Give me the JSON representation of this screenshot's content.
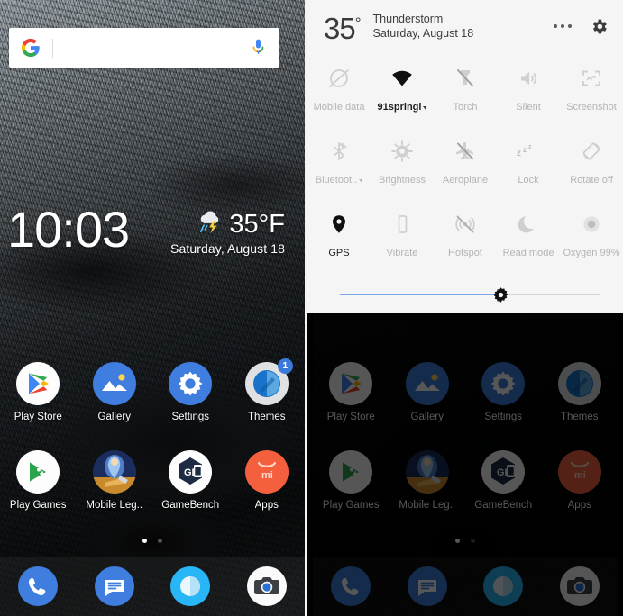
{
  "home": {
    "search": {
      "placeholder": "",
      "value": "",
      "logo": "google-g-logo",
      "mic": "microphone-icon"
    },
    "clock": {
      "time": "10:03",
      "temperature": "35°F",
      "date": "Saturday, August 18",
      "condition_icon": "thunderstorm-icon"
    },
    "apps": [
      [
        {
          "label": "Play Store",
          "icon": "play-store-icon",
          "badge": ""
        },
        {
          "label": "Gallery",
          "icon": "gallery-icon",
          "badge": ""
        },
        {
          "label": "Settings",
          "icon": "settings-gear-icon",
          "badge": ""
        },
        {
          "label": "Themes",
          "icon": "themes-icon",
          "badge": "1"
        }
      ],
      [
        {
          "label": "Play Games",
          "icon": "play-games-icon",
          "badge": ""
        },
        {
          "label": "Mobile Leg..",
          "icon": "mobile-legends-icon",
          "badge": ""
        },
        {
          "label": "GameBench",
          "icon": "gamebench-icon",
          "badge": ""
        },
        {
          "label": "Apps",
          "icon": "mi-apps-icon",
          "badge": ""
        }
      ]
    ],
    "pages": {
      "count": 2,
      "active": 1
    },
    "dock": [
      {
        "label": "Phone",
        "icon": "phone-icon"
      },
      {
        "label": "Messages",
        "icon": "messages-icon"
      },
      {
        "label": "Browser",
        "icon": "browser-icon"
      },
      {
        "label": "Camera",
        "icon": "camera-icon"
      }
    ]
  },
  "quick_settings": {
    "header": {
      "temperature": "35",
      "degree": "°",
      "condition": "Thunderstorm",
      "date": "Saturday, August 18",
      "overflow_icon": "more-options-icon",
      "settings_icon": "gear-icon"
    },
    "tiles": [
      [
        {
          "label": "Mobile data",
          "icon": "mobile-data-off-icon",
          "enabled": false,
          "has_caret": false
        },
        {
          "label": "91springl",
          "icon": "wifi-icon",
          "enabled": true,
          "has_caret": true
        },
        {
          "label": "Torch",
          "icon": "torch-off-icon",
          "enabled": false,
          "has_caret": false
        },
        {
          "label": "Silent",
          "icon": "volume-icon",
          "enabled": false,
          "has_caret": false
        },
        {
          "label": "Screenshot",
          "icon": "screenshot-icon",
          "enabled": false,
          "has_caret": false
        }
      ],
      [
        {
          "label": "Bluetoot..",
          "icon": "bluetooth-off-icon",
          "enabled": false,
          "has_caret": true
        },
        {
          "label": "Brightness",
          "icon": "brightness-icon",
          "enabled": false,
          "has_caret": false
        },
        {
          "label": "Aeroplane",
          "icon": "aeroplane-off-icon",
          "enabled": false,
          "has_caret": false
        },
        {
          "label": "Lock",
          "icon": "sleep-zzz-icon",
          "enabled": false,
          "has_caret": false
        },
        {
          "label": "Rotate off",
          "icon": "rotate-off-icon",
          "enabled": false,
          "has_caret": false
        }
      ],
      [
        {
          "label": "GPS",
          "icon": "location-pin-icon",
          "enabled": true,
          "has_caret": false
        },
        {
          "label": "Vibrate",
          "icon": "vibrate-icon",
          "enabled": false,
          "has_caret": false
        },
        {
          "label": "Hotspot",
          "icon": "hotspot-off-icon",
          "enabled": false,
          "has_caret": false
        },
        {
          "label": "Read mode",
          "icon": "moon-icon",
          "enabled": false,
          "has_caret": false
        },
        {
          "label": "Oxygen 99%",
          "icon": "oxygen-icon",
          "enabled": false,
          "has_caret": false
        }
      ]
    ],
    "brightness": {
      "percent": 62,
      "knob_icon": "brightness-knob-icon",
      "fill_color": "#7aa7e8",
      "track_color": "#d6d6d6"
    }
  }
}
